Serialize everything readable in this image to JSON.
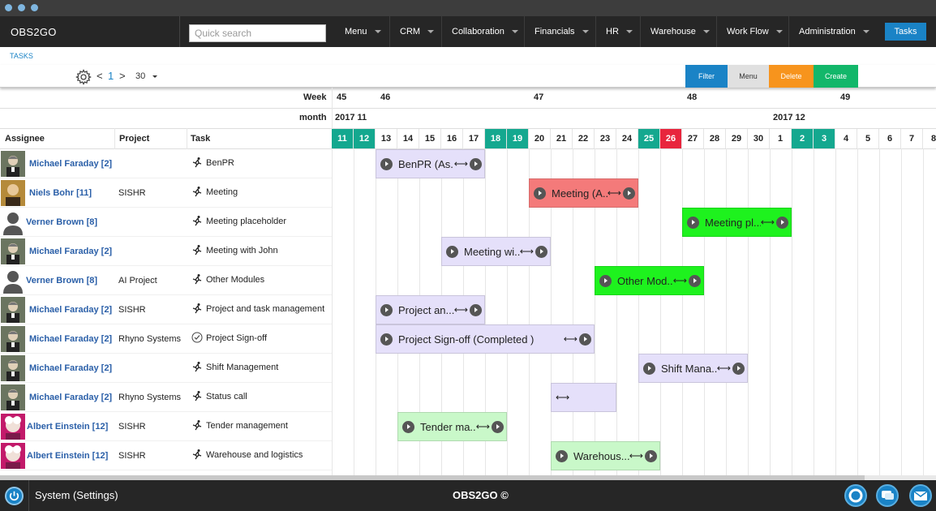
{
  "app": {
    "brand": "OBS2GO"
  },
  "search": {
    "placeholder": "Quick search"
  },
  "nav": [
    {
      "label": "Menu"
    },
    {
      "label": "CRM"
    },
    {
      "label": "Collaboration"
    },
    {
      "label": "Financials"
    },
    {
      "label": "HR"
    },
    {
      "label": "Warehouse"
    },
    {
      "label": "Work Flow"
    },
    {
      "label": "Administration"
    }
  ],
  "nav_active": "Tasks",
  "breadcrumb": "TASKS",
  "pager": {
    "prev": "<",
    "current": "1",
    "next": ">",
    "page_size": "30"
  },
  "toolbar": {
    "filter": "Filter",
    "menu": "Menu",
    "delete": "Delete",
    "create": "Create"
  },
  "colors": {
    "accent": "#1a83c6",
    "weekend": "#14a88f",
    "today": "#e8253d",
    "filter": "#1a83c6",
    "menu": "#e0e0e0",
    "delete": "#f7941d",
    "create": "#12b76a",
    "bar_lavender": "#e5e0fa",
    "bar_red": "#f47a7a",
    "bar_green": "#1ef21e",
    "bar_lightgreen": "#c9f8c9"
  },
  "headers": {
    "week": "Week",
    "month": "month",
    "assignee": "Assignee",
    "project": "Project",
    "task": "Task"
  },
  "weeks": [
    "45",
    "46",
    "47",
    "48",
    "49"
  ],
  "months": [
    "2017 11",
    "2017 12"
  ],
  "days": [
    {
      "d": "11",
      "t": "weekend"
    },
    {
      "d": "12",
      "t": "weekend"
    },
    {
      "d": "13",
      "t": ""
    },
    {
      "d": "14",
      "t": ""
    },
    {
      "d": "15",
      "t": ""
    },
    {
      "d": "16",
      "t": ""
    },
    {
      "d": "17",
      "t": ""
    },
    {
      "d": "18",
      "t": "weekend"
    },
    {
      "d": "19",
      "t": "weekend"
    },
    {
      "d": "20",
      "t": ""
    },
    {
      "d": "21",
      "t": ""
    },
    {
      "d": "22",
      "t": ""
    },
    {
      "d": "23",
      "t": ""
    },
    {
      "d": "24",
      "t": ""
    },
    {
      "d": "25",
      "t": "weekend"
    },
    {
      "d": "26",
      "t": "today"
    },
    {
      "d": "27",
      "t": ""
    },
    {
      "d": "28",
      "t": ""
    },
    {
      "d": "29",
      "t": ""
    },
    {
      "d": "30",
      "t": ""
    },
    {
      "d": "1",
      "t": ""
    },
    {
      "d": "2",
      "t": "weekend"
    },
    {
      "d": "3",
      "t": "weekend"
    },
    {
      "d": "4",
      "t": ""
    },
    {
      "d": "5",
      "t": ""
    },
    {
      "d": "6",
      "t": ""
    },
    {
      "d": "7",
      "t": ""
    },
    {
      "d": "8",
      "t": ""
    }
  ],
  "rows": [
    {
      "assignee": "Michael Faraday [2]",
      "avatar": "faraday",
      "project": "",
      "task": "BenPR",
      "icon": "run",
      "bar": {
        "label": "BenPR (As...",
        "start": 2,
        "len": 5,
        "color": "lavender",
        "arrow": "⟷"
      }
    },
    {
      "assignee": "Niels Bohr [11]",
      "avatar": "bohr",
      "project": "SISHR",
      "task": "Meeting",
      "icon": "run",
      "bar": {
        "label": "Meeting (A...",
        "start": 9,
        "len": 5,
        "color": "red",
        "arrow": "⟷"
      }
    },
    {
      "assignee": "Verner Brown [8]",
      "avatar": "generic",
      "project": "",
      "task": "Meeting placeholder",
      "icon": "run",
      "bar": {
        "label": "Meeting pl...",
        "start": 16,
        "len": 5,
        "color": "green",
        "arrow": "⟷"
      }
    },
    {
      "assignee": "Michael Faraday [2]",
      "avatar": "faraday",
      "project": "",
      "task": "Meeting with John",
      "icon": "run",
      "bar": {
        "label": "Meeting wi...",
        "start": 5,
        "len": 5,
        "color": "lavender",
        "arrow": "⟷"
      }
    },
    {
      "assignee": "Verner Brown [8]",
      "avatar": "generic",
      "project": "AI Project",
      "task": "Other Modules",
      "icon": "run",
      "bar": {
        "label": "Other Mod...",
        "start": 12,
        "len": 5,
        "color": "green",
        "arrow": "⟷"
      }
    },
    {
      "assignee": "Michael Faraday [2]",
      "avatar": "faraday",
      "project": "SISHR",
      "task": "Project and task management",
      "icon": "run",
      "bar": {
        "label": "Project an...",
        "start": 2,
        "len": 5,
        "color": "lavender",
        "arrow": "⟷"
      }
    },
    {
      "assignee": "Michael Faraday [2]",
      "avatar": "faraday",
      "project": "Rhyno Systems",
      "task": "Project Sign-off",
      "icon": "check",
      "bar": {
        "label": "Project Sign-off (Completed )",
        "start": 2,
        "len": 10,
        "color": "lavender",
        "arrow": "⟷"
      }
    },
    {
      "assignee": "Michael Faraday [2]",
      "avatar": "faraday",
      "project": "",
      "task": "Shift Management",
      "icon": "run",
      "bar": {
        "label": "Shift Mana...",
        "start": 14,
        "len": 5,
        "color": "lavender",
        "arrow": "⟷"
      }
    },
    {
      "assignee": "Michael Faraday [2]",
      "avatar": "faraday",
      "project": "Rhyno Systems",
      "task": "Status call",
      "icon": "run",
      "bar": {
        "label": "",
        "start": 10,
        "len": 3,
        "color": "lavender",
        "arrow": "⟷",
        "nocircle": true
      }
    },
    {
      "assignee": "Albert Einstein [12]",
      "avatar": "einstein",
      "project": "SISHR",
      "task": "Tender management",
      "icon": "run",
      "bar": {
        "label": "Tender ma...",
        "start": 3,
        "len": 5,
        "color": "lightgreen",
        "arrow": "⟷"
      }
    },
    {
      "assignee": "Albert Einstein [12]",
      "avatar": "einstein",
      "project": "SISHR",
      "task": "Warehouse and logistics",
      "icon": "run",
      "bar": {
        "label": "Warehous...",
        "start": 10,
        "len": 5,
        "color": "lightgreen",
        "arrow": "⟷"
      }
    }
  ],
  "footer": {
    "system": "System (Settings)",
    "brand": "OBS2GO ©"
  },
  "footer_icons": [
    "lifebuoy-icon",
    "chat-icon",
    "mail-icon"
  ]
}
